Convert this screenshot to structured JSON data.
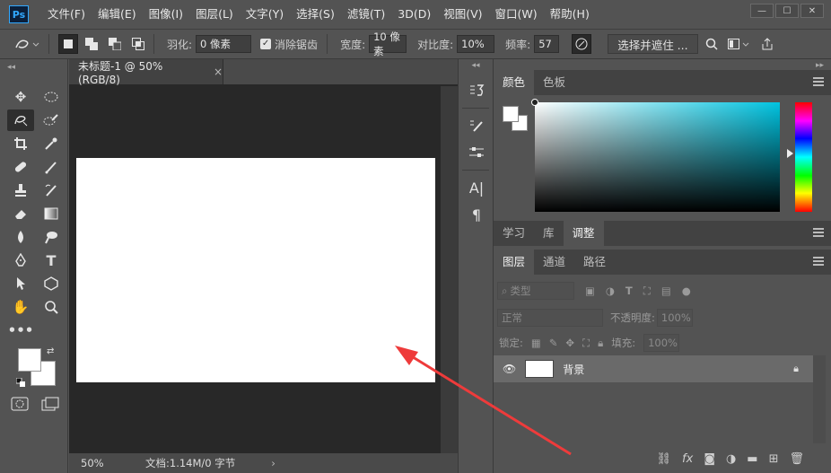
{
  "app": {
    "logo_text": "Ps"
  },
  "menubar": {
    "items": [
      "文件(F)",
      "编辑(E)",
      "图像(I)",
      "图层(L)",
      "文字(Y)",
      "选择(S)",
      "滤镜(T)",
      "3D(D)",
      "视图(V)",
      "窗口(W)",
      "帮助(H)"
    ],
    "window_buttons": [
      "—",
      "☐",
      "✕"
    ]
  },
  "optbar": {
    "feather_label": "羽化:",
    "feather_value": "0 像素",
    "antialias_label": "消除锯齿",
    "width_label": "宽度:",
    "width_value": "10 像素",
    "contrast_label": "对比度:",
    "contrast_value": "10%",
    "frequency_label": "频率:",
    "frequency_value": "57",
    "select_mask_label": "选择并遮住 ..."
  },
  "document": {
    "tab_title": "未标题-1 @ 50%(RGB/8)",
    "tab_close": "×",
    "zoom": "50%",
    "doc_info": "文档:1.14M/0 字节"
  },
  "color_panel": {
    "tabs": [
      "颜色",
      "色板"
    ],
    "active_tab": "颜色",
    "sat_hue_color": "#00c3e0"
  },
  "mid_panel": {
    "tabs": [
      "学习",
      "库",
      "调整"
    ],
    "active_tab": "调整"
  },
  "layers_panel": {
    "tabs": [
      "图层",
      "通道",
      "路径"
    ],
    "active_tab": "图层",
    "filter_label": "类型",
    "blend_mode": "正常",
    "opacity_label": "不透明度:",
    "opacity_value": "100%",
    "lock_label": "锁定:",
    "fill_label": "填充:",
    "fill_value": "100%",
    "layers": [
      {
        "name": "背景"
      }
    ]
  },
  "annotation": {
    "arrow_color": "#ee3b3b"
  }
}
